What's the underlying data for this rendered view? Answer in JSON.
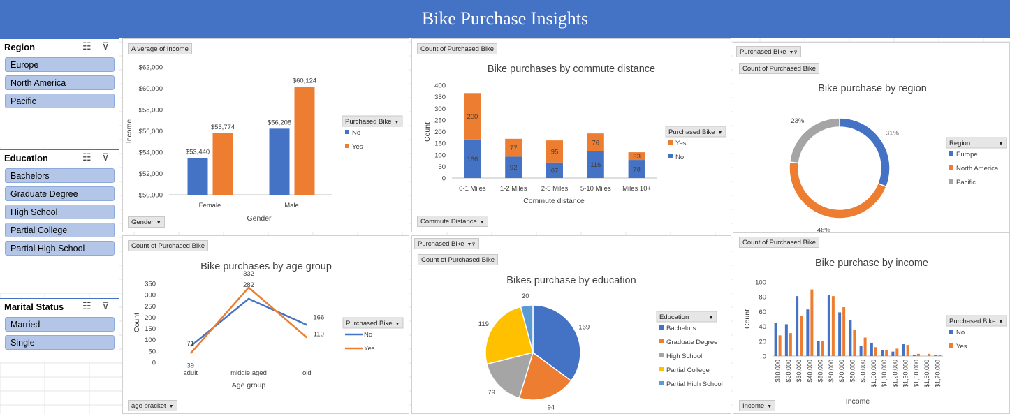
{
  "banner": {
    "title": "Bike Purchase Insights"
  },
  "colors": {
    "blue": "#4472c4",
    "orange": "#ed7d31",
    "gray": "#a5a5a5",
    "yellow": "#ffc000",
    "lightblue": "#5b9bd5",
    "slicer_btn": "#b4c6e7"
  },
  "slicers": {
    "region": {
      "title": "Region",
      "items": [
        "Europe",
        "North America",
        "Pacific"
      ]
    },
    "education": {
      "title": "Education",
      "items": [
        "Bachelors",
        "Graduate Degree",
        "High School",
        "Partial College",
        "Partial High School"
      ]
    },
    "marital": {
      "title": "Marital Status",
      "items": [
        "Married",
        "Single"
      ]
    }
  },
  "fields": {
    "avg_income": "A verage of Income",
    "gender": "Gender",
    "count_purchased_1": "Count of Purchased Bike",
    "commute_distance": "Commute Distance",
    "purchased_bike_filter_1": "Purchased Bike",
    "count_purchased_2": "Count of Purchased Bike",
    "count_purchased_3": "Count of Purchased Bike",
    "age_bracket": "age bracket",
    "purchased_bike_filter_2": "Purchased Bike",
    "count_purchased_4": "Count of Purchased Bike",
    "count_purchased_5": "Count of Purchased Bike",
    "income": "Income"
  },
  "chart_data": [
    {
      "id": "gender_income",
      "type": "bar",
      "title": "",
      "xlabel": "Gender",
      "ylabel": "Income",
      "categories": [
        "Female",
        "Male"
      ],
      "series": [
        {
          "name": "No",
          "values": [
            53440,
            56208
          ]
        },
        {
          "name": "Yes",
          "values": [
            55774,
            60124
          ]
        }
      ],
      "data_labels": [
        [
          "$53,440",
          "$56,208"
        ],
        [
          "$55,774",
          "$60,124"
        ]
      ],
      "ylim": [
        50000,
        62000
      ],
      "yticks": [
        "$50,000",
        "$52,000",
        "$54,000",
        "$56,000",
        "$58,000",
        "$60,000",
        "$62,000"
      ],
      "legend_title": "Purchased Bike",
      "legend": "right"
    },
    {
      "id": "commute",
      "type": "bar",
      "stacked": true,
      "title": "Bike purchases by commute distance",
      "xlabel": "Commute distance",
      "ylabel": "Count",
      "categories": [
        "0-1 Miles",
        "1-2 Miles",
        "2-5 Miles",
        "5-10 Miles",
        "Miles 10+"
      ],
      "series": [
        {
          "name": "No",
          "values": [
            166,
            92,
            67,
            116,
            78
          ]
        },
        {
          "name": "Yes",
          "values": [
            200,
            77,
            95,
            76,
            33
          ]
        }
      ],
      "ylim": [
        0,
        400
      ],
      "yticks": [
        "0",
        "50",
        "100",
        "150",
        "200",
        "250",
        "300",
        "350",
        "400"
      ],
      "legend_title": "Purchased Bike",
      "legend_order": [
        "Yes",
        "No"
      ],
      "legend": "right"
    },
    {
      "id": "region",
      "type": "pie",
      "donut": true,
      "title": "Bike purchase by region",
      "labels": [
        "Europe",
        "North America",
        "Pacific"
      ],
      "values": [
        31,
        46,
        23
      ],
      "pct_labels": [
        "31%",
        "46%",
        "23%"
      ],
      "legend_title": "Region",
      "legend": "right"
    },
    {
      "id": "age",
      "type": "line",
      "title": "Bike purchases by age group",
      "xlabel": "Age group",
      "ylabel": "Count",
      "categories": [
        "adult",
        "middle aged",
        "old"
      ],
      "series": [
        {
          "name": "No",
          "values": [
            71,
            282,
            166
          ]
        },
        {
          "name": "Yes",
          "values": [
            39,
            332,
            110
          ]
        }
      ],
      "ylim": [
        0,
        350
      ],
      "yticks": [
        "0",
        "50",
        "100",
        "150",
        "200",
        "250",
        "300",
        "350"
      ],
      "legend_title": "Purchased Bike",
      "legend": "right"
    },
    {
      "id": "education",
      "type": "pie",
      "title": "Bikes purchase by education",
      "labels": [
        "Bachelors",
        "Graduate Degree",
        "High School",
        "Partial College",
        "Partial High School"
      ],
      "values": [
        169,
        94,
        79,
        119,
        20
      ],
      "legend_title": "Education",
      "legend": "right"
    },
    {
      "id": "income",
      "type": "bar",
      "title": "Bike purchase by income",
      "xlabel": "Income",
      "ylabel": "Count",
      "categories": [
        "$10,000",
        "$20,000",
        "$30,000",
        "$40,000",
        "$50,000",
        "$60,000",
        "$70,000",
        "$80,000",
        "$90,000",
        "$1,00,000",
        "$1,10,000",
        "$1,20,000",
        "$1,30,000",
        "$1,50,000",
        "$1,60,000",
        "$1,70,000"
      ],
      "series": [
        {
          "name": "No",
          "values": [
            45,
            43,
            81,
            63,
            20,
            83,
            59,
            49,
            14,
            18,
            8,
            6,
            16,
            1,
            0,
            1
          ]
        },
        {
          "name": "Yes",
          "values": [
            28,
            31,
            54,
            90,
            20,
            81,
            66,
            35,
            25,
            12,
            8,
            10,
            15,
            3,
            3,
            1
          ]
        }
      ],
      "ylim": [
        0,
        100
      ],
      "yticks": [
        "0",
        "20",
        "40",
        "60",
        "80",
        "100"
      ],
      "legend_title": "Purchased Bike",
      "legend": "right"
    }
  ]
}
